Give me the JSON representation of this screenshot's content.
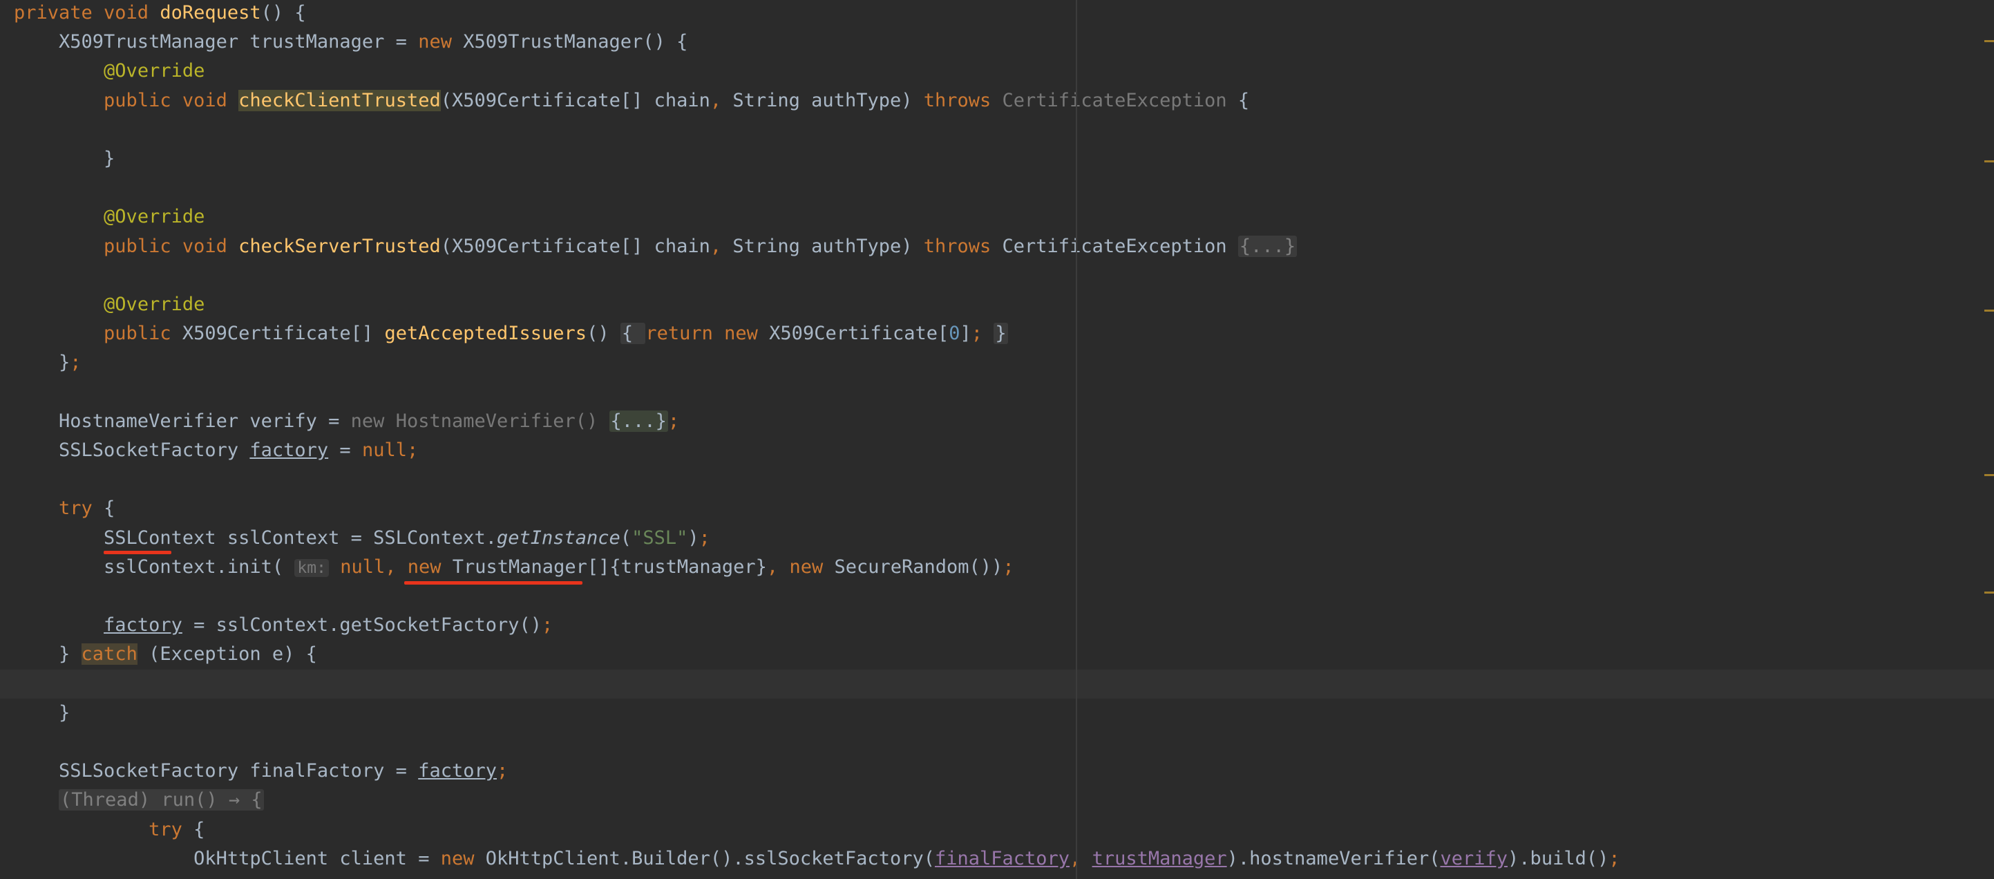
{
  "editor": {
    "colors": {
      "background": "#2b2b2b",
      "keyword": "#cc7832",
      "annotation": "#bbb529",
      "method": "#ffc66d",
      "number": "#6897bb",
      "string": "#6a8759",
      "field": "#9876aa",
      "annotation_red_underline": "#e8341c"
    },
    "lines": [
      [
        {
          "t": "private void ",
          "c": "kw"
        },
        {
          "t": "doRequest",
          "c": "fn"
        },
        {
          "t": "() {"
        }
      ],
      [
        {
          "t": "    X509TrustManager trustManager = "
        },
        {
          "t": "new ",
          "c": "kw"
        },
        {
          "t": "X509TrustManager() {"
        }
      ],
      [
        {
          "t": "        "
        },
        {
          "t": "@Override",
          "c": "ann"
        }
      ],
      [
        {
          "t": "        "
        },
        {
          "t": "public void ",
          "c": "kw"
        },
        {
          "t": "checkClientTrusted",
          "c": "fn hl"
        },
        {
          "t": "(X509Certificate[] chain"
        },
        {
          "t": ", ",
          "c": "kw"
        },
        {
          "t": "String authType) "
        },
        {
          "t": "throws ",
          "c": "kw"
        },
        {
          "t": "CertificateException",
          "c": "gray"
        },
        {
          "t": " {"
        }
      ],
      [
        {
          "t": ""
        }
      ],
      [
        {
          "t": "        }"
        }
      ],
      [
        {
          "t": ""
        }
      ],
      [
        {
          "t": "        "
        },
        {
          "t": "@Override",
          "c": "ann"
        }
      ],
      [
        {
          "t": "        "
        },
        {
          "t": "public void ",
          "c": "kw"
        },
        {
          "t": "checkServerTrusted",
          "c": "fn"
        },
        {
          "t": "(X509Certificate[] chain"
        },
        {
          "t": ", ",
          "c": "kw"
        },
        {
          "t": "String authType) "
        },
        {
          "t": "throws ",
          "c": "kw"
        },
        {
          "t": "CertificateException "
        },
        {
          "t": "{...}",
          "c": "fold-gray"
        }
      ],
      [
        {
          "t": ""
        }
      ],
      [
        {
          "t": "        "
        },
        {
          "t": "@Override",
          "c": "ann"
        }
      ],
      [
        {
          "t": "        "
        },
        {
          "t": "public ",
          "c": "kw"
        },
        {
          "t": "X509Certificate[] "
        },
        {
          "t": "getAcceptedIssuers",
          "c": "fn"
        },
        {
          "t": "() "
        },
        {
          "t": "{ ",
          "c": "fold"
        },
        {
          "t": "return new ",
          "c": "kw"
        },
        {
          "t": "X509Certificate["
        },
        {
          "t": "0",
          "c": "num"
        },
        {
          "t": "]"
        },
        {
          "t": "; ",
          "c": "kw"
        },
        {
          "t": "}",
          "c": "fold"
        }
      ],
      [
        {
          "t": "    }"
        },
        {
          "t": ";",
          "c": "kw"
        }
      ],
      [
        {
          "t": ""
        }
      ],
      [
        {
          "t": "    HostnameVerifier verify = "
        },
        {
          "t": "new HostnameVerifier() ",
          "c": "gray"
        },
        {
          "t": "{...}",
          "c": "fold-green"
        },
        {
          "t": ";",
          "c": "kw"
        }
      ],
      [
        {
          "t": "    SSLSocketFactory "
        },
        {
          "t": "factory",
          "c": "ul"
        },
        {
          "t": " = "
        },
        {
          "t": "null;",
          "c": "kw"
        }
      ],
      [
        {
          "t": ""
        }
      ],
      [
        {
          "t": "    "
        },
        {
          "t": "try ",
          "c": "kw"
        },
        {
          "t": "{"
        }
      ],
      [
        {
          "t": "        SSLContext sslContext = SSLContext."
        },
        {
          "t": "getInstance",
          "c": "ital"
        },
        {
          "t": "("
        },
        {
          "t": "\"SSL\"",
          "c": "str"
        },
        {
          "t": ")"
        },
        {
          "t": ";",
          "c": "kw"
        }
      ],
      [
        {
          "t": "        sslContext.init( "
        },
        {
          "t": "km:",
          "c": "hint"
        },
        {
          "t": " null, ",
          "c": "kw"
        },
        {
          "t": "new ",
          "c": "kw"
        },
        {
          "t": "TrustManager[]{trustManager}"
        },
        {
          "t": ", ",
          "c": "kw"
        },
        {
          "t": "new ",
          "c": "kw"
        },
        {
          "t": "SecureRandom())"
        },
        {
          "t": ";",
          "c": "kw"
        }
      ],
      [
        {
          "t": ""
        }
      ],
      [
        {
          "t": "        "
        },
        {
          "t": "factory",
          "c": "ul"
        },
        {
          "t": " = sslContext.getSocketFactory()"
        },
        {
          "t": ";",
          "c": "kw"
        }
      ],
      [
        {
          "t": "    } "
        },
        {
          "t": "catch",
          "c": "hl-catch"
        },
        {
          "t": " (Exception e) {"
        }
      ],
      [
        {
          "t": ""
        }
      ],
      [
        {
          "t": "    }"
        }
      ],
      [
        {
          "t": ""
        }
      ],
      [
        {
          "t": "    SSLSocketFactory finalFactory = "
        },
        {
          "t": "factory",
          "c": "ul"
        },
        {
          "t": ";",
          "c": "kw"
        }
      ],
      [
        {
          "t": "    "
        },
        {
          "t": "(Thread) run() → {",
          "c": "fold-gray"
        }
      ],
      [
        {
          "t": "            "
        },
        {
          "t": "try ",
          "c": "kw"
        },
        {
          "t": "{"
        }
      ],
      [
        {
          "t": "                OkHttpClient client = "
        },
        {
          "t": "new ",
          "c": "kw"
        },
        {
          "t": "OkHttpClient.Builder().sslSocketFactory("
        },
        {
          "t": "finalFactory",
          "c": "under-purple"
        },
        {
          "t": ", ",
          "c": "kw"
        },
        {
          "t": "trustManager",
          "c": "under-purple"
        },
        {
          "t": ").hostnameVerifier("
        },
        {
          "t": "verify",
          "c": "under-purple"
        },
        {
          "t": ").build()"
        },
        {
          "t": ";",
          "c": "kw"
        }
      ]
    ]
  }
}
